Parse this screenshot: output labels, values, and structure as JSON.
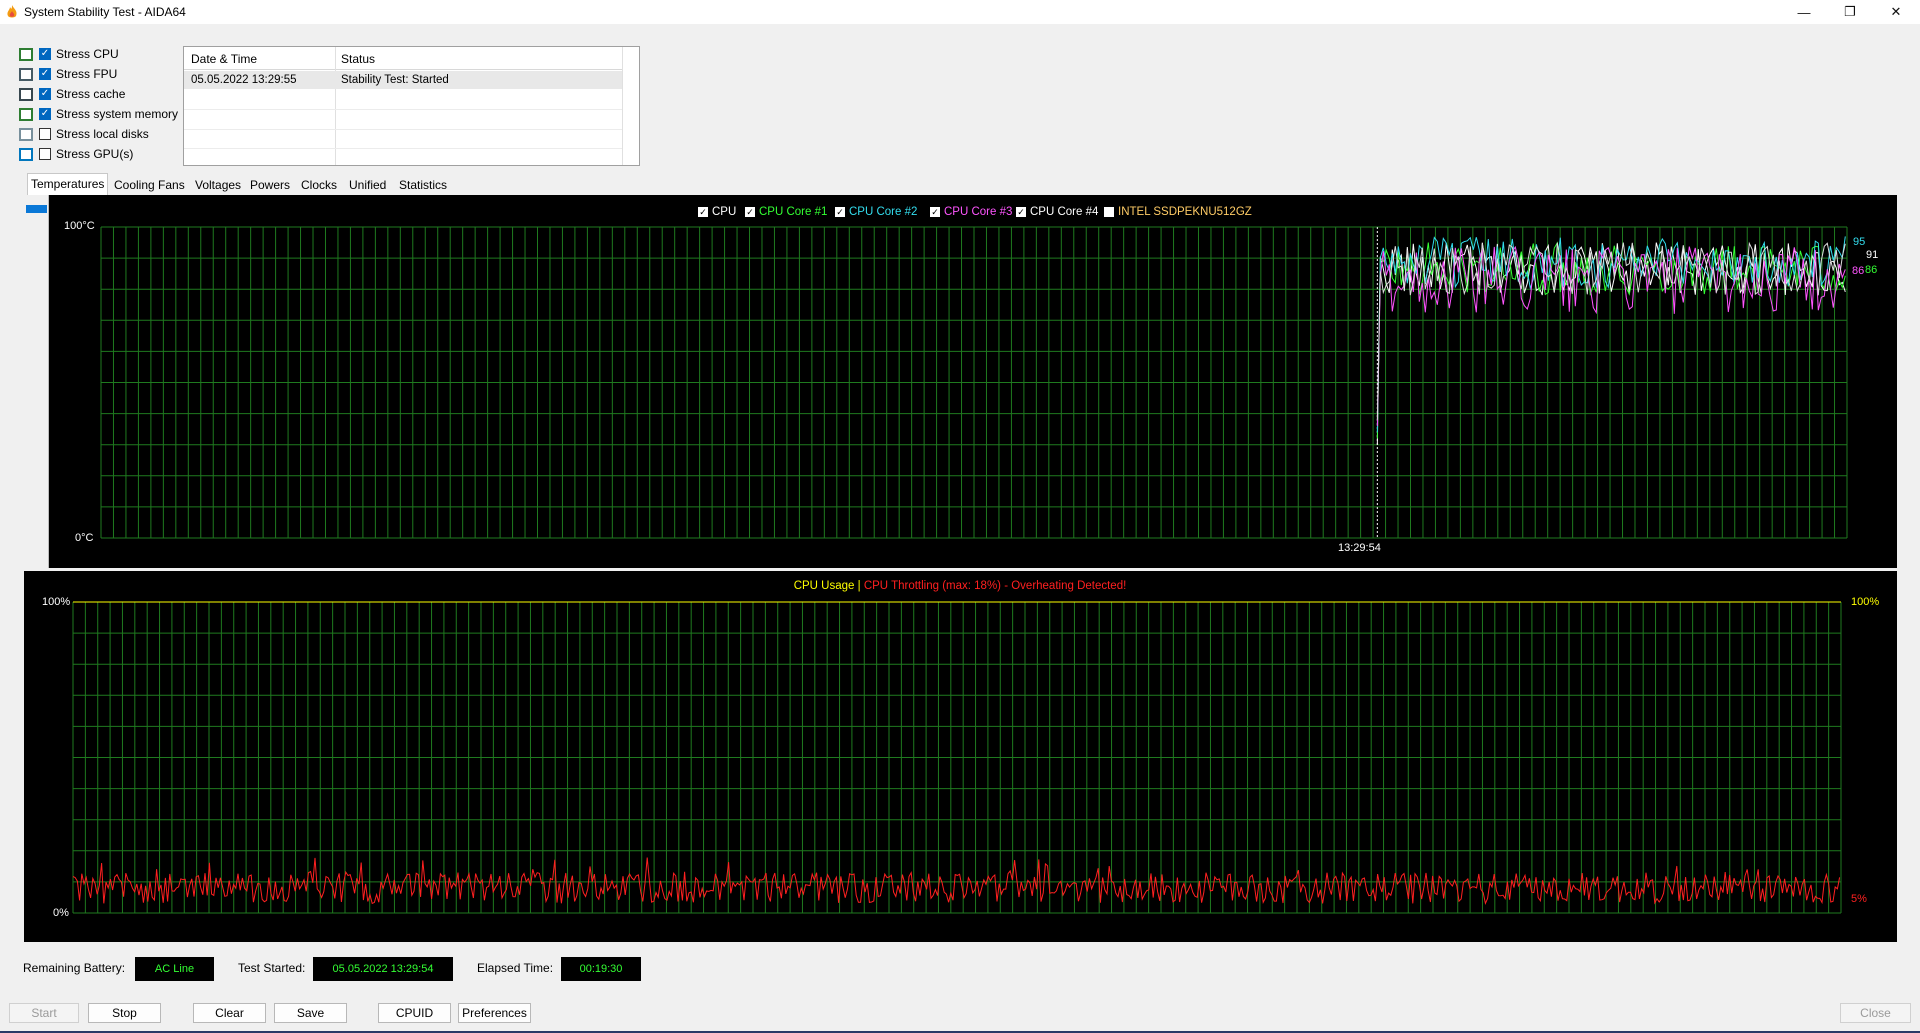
{
  "window": {
    "title": "System Stability Test - AIDA64",
    "controls": {
      "minimize": "—",
      "maximize": "❐",
      "close": "✕"
    }
  },
  "stress_options": [
    {
      "label": "Stress CPU",
      "checked": true,
      "icon": "cpu-icon"
    },
    {
      "label": "Stress FPU",
      "checked": true,
      "icon": "fpu-icon"
    },
    {
      "label": "Stress cache",
      "checked": true,
      "icon": "cache-icon"
    },
    {
      "label": "Stress system memory",
      "checked": true,
      "icon": "memory-icon"
    },
    {
      "label": "Stress local disks",
      "checked": false,
      "icon": "disk-icon"
    },
    {
      "label": "Stress GPU(s)",
      "checked": false,
      "icon": "gpu-icon"
    }
  ],
  "log": {
    "headers": [
      "Date & Time",
      "Status"
    ],
    "rows": [
      {
        "datetime": "05.05.2022 13:29:55",
        "status": "Stability Test: Started"
      }
    ]
  },
  "tabs": [
    "Temperatures",
    "Cooling Fans",
    "Voltages",
    "Powers",
    "Clocks",
    "Unified",
    "Statistics"
  ],
  "temperature_graph": {
    "legend": [
      {
        "label": "CPU",
        "color": "#ffffff"
      },
      {
        "label": "CPU Core #1",
        "color": "#33ff33"
      },
      {
        "label": "CPU Core #2",
        "color": "#33ddee"
      },
      {
        "label": "CPU Core #3",
        "color": "#ff55ff"
      },
      {
        "label": "CPU Core #4",
        "color": "#ffffff"
      },
      {
        "label": "INTEL SSDPEKNU512GZ",
        "color": "#ffcc66"
      }
    ],
    "y_max_label": "100°C",
    "y_min_label": "0°C",
    "time_label": "13:29:54",
    "end_values": [
      {
        "value": "95",
        "color": "#33ddee"
      },
      {
        "value": "91",
        "color": "#ffffff"
      },
      {
        "value": "86",
        "color": "#ff55ff"
      },
      {
        "value": "86",
        "color": "#33ff33"
      }
    ]
  },
  "cpu_graph": {
    "title_usage": "CPU Usage",
    "title_sep": "|",
    "title_throttle": "CPU Throttling (max: 18%) - Overheating Detected!",
    "y_max_left": "100%",
    "y_min_left": "0%",
    "y_max_right": "100%",
    "end_value": "5%",
    "usage_color": "#ffff00",
    "throttle_color": "#ff2020"
  },
  "chart_data": [
    {
      "type": "line",
      "title": "Temperatures",
      "ylim": [
        0,
        100
      ],
      "ylabel": "°C",
      "series": [
        {
          "name": "CPU",
          "y_range_after_start": [
            78,
            95
          ],
          "current": 91
        },
        {
          "name": "CPU Core #1",
          "y_range_after_start": [
            78,
            95
          ],
          "current": 86
        },
        {
          "name": "CPU Core #2",
          "y_range_after_start": [
            80,
            97
          ],
          "current": 95
        },
        {
          "name": "CPU Core #3",
          "y_range_after_start": [
            72,
            94
          ],
          "current": 86
        },
        {
          "name": "CPU Core #4",
          "y_range_after_start": [
            78,
            95
          ],
          "current": 91
        }
      ],
      "x": [
        "13:29:54"
      ]
    },
    {
      "type": "line",
      "title": "CPU Usage | CPU Throttling (max: 18%) - Overheating Detected!",
      "ylim": [
        0,
        100
      ],
      "series": [
        {
          "name": "CPU Throttling",
          "y_range": [
            0,
            18
          ],
          "max": 18,
          "current": 5
        }
      ]
    }
  ],
  "status": {
    "battery_label": "Remaining Battery:",
    "battery_value": "AC Line",
    "started_label": "Test Started:",
    "started_value": "05.05.2022 13:29:54",
    "elapsed_label": "Elapsed Time:",
    "elapsed_value": "00:19:30"
  },
  "buttons": {
    "start": "Start",
    "stop": "Stop",
    "clear": "Clear",
    "save": "Save",
    "cpuid": "CPUID",
    "preferences": "Preferences",
    "close": "Close"
  }
}
